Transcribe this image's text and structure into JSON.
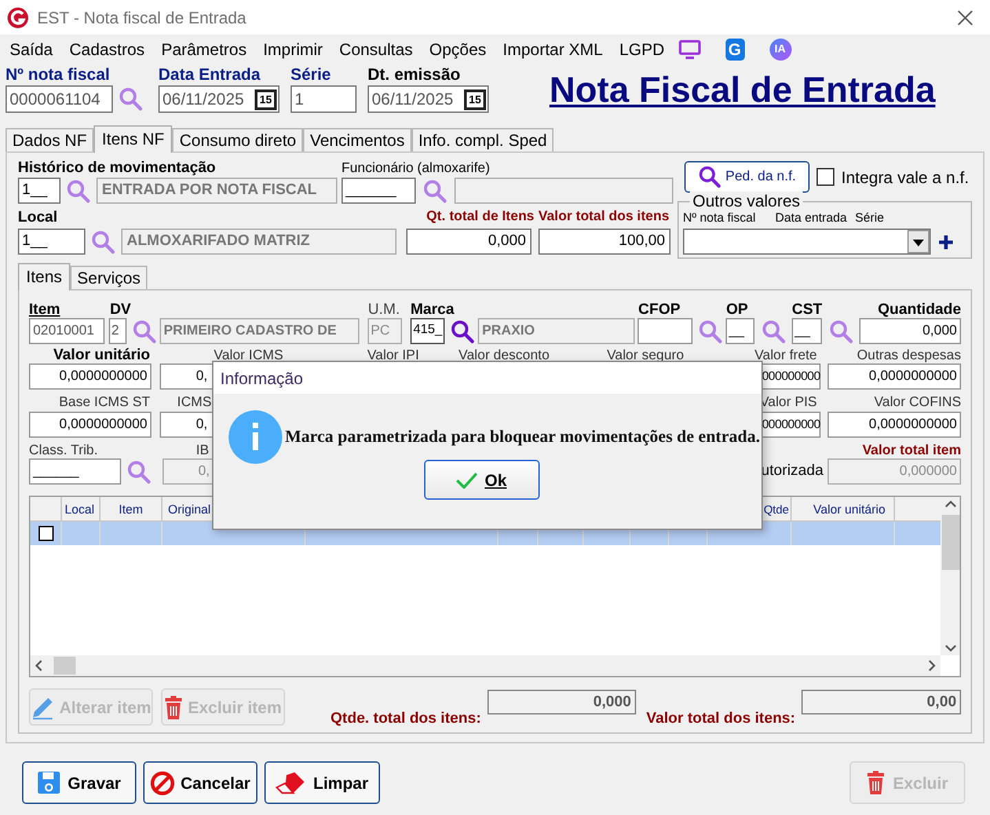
{
  "window": {
    "title": "EST - Nota fiscal de Entrada"
  },
  "menu": [
    "Saída",
    "Cadastros",
    "Parâmetros",
    "Imprimir",
    "Consultas",
    "Opções",
    "Importar XML",
    "LGPD"
  ],
  "menu_badges": {
    "g": "G",
    "ia": "IA"
  },
  "header": {
    "numero": {
      "label": "Nº nota fiscal",
      "value": "0000061104"
    },
    "data_entrada": {
      "label": "Data Entrada",
      "value": "06/11/2025",
      "calendar": "15"
    },
    "serie": {
      "label": "Série",
      "value": "1"
    },
    "dt_emissao": {
      "label": "Dt. emissão",
      "value": "06/11/2025",
      "calendar": "15"
    },
    "title": "Nota Fiscal de Entrada"
  },
  "tabs": [
    {
      "label": "Dados NF",
      "selected": false
    },
    {
      "label": "Itens NF",
      "selected": true
    },
    {
      "label": "Consumo direto",
      "selected": false
    },
    {
      "label": "Vencimentos",
      "selected": false
    },
    {
      "label": "Info. compl. Sped",
      "selected": false
    }
  ],
  "movimentacao": {
    "historico": {
      "label": "Histórico de movimentação",
      "code": "1__",
      "description": "ENTRADA POR NOTA FISCAL"
    },
    "funcionario": {
      "label": "Funcionário (almoxarife)",
      "code": "______"
    },
    "ped_button": "Ped. da n.f.",
    "integra": {
      "label": "Integra vale a n.f.",
      "checked": false
    },
    "local": {
      "label": "Local",
      "code": "1__",
      "description": "ALMOXARIFADO MATRIZ"
    },
    "qt_total": {
      "label": "Qt. total de Itens",
      "value": "0,000"
    },
    "valor_total": {
      "label": "Valor total dos itens",
      "value": "100,00"
    },
    "outros": {
      "legend": "Outros valores",
      "columns": [
        "Nº nota fiscal",
        "Data entrada",
        "Série"
      ]
    }
  },
  "subtabs": [
    {
      "label": "Itens",
      "selected": true
    },
    {
      "label": "Serviços",
      "selected": false
    }
  ],
  "item": {
    "item": {
      "label": "Item",
      "value": "02010001"
    },
    "dv": {
      "label": "DV",
      "value": "2",
      "description": "PRIMEIRO CADASTRO DE"
    },
    "um": {
      "label": "U.M.",
      "value": "PC"
    },
    "marca": {
      "label": "Marca",
      "value": "415_",
      "description": "PRAXIO"
    },
    "cfop": {
      "label": "CFOP"
    },
    "op": {
      "label": "OP",
      "value": "__"
    },
    "cst": {
      "label": "CST",
      "value": "__"
    },
    "quantidade": {
      "label": "Quantidade",
      "value": "0,000"
    },
    "valor_unitario": {
      "label": "Valor unitário",
      "value": "0,0000000000"
    },
    "valor_icms": {
      "label": "Valor ICMS",
      "value": "0,"
    },
    "valor_ipi": {
      "label": "Valor IPI"
    },
    "valor_desconto": {
      "label": "Valor desconto"
    },
    "valor_seguro": {
      "label": "Valor seguro"
    },
    "valor_frete": {
      "label": "Valor frete",
      "value": "000000000"
    },
    "outras_despesas": {
      "label": "Outras despesas",
      "value": "0,0000000000"
    },
    "base_icms_st": {
      "label": "Base ICMS ST",
      "value": "0,0000000000"
    },
    "icms": {
      "label": "ICMS",
      "value": "0,"
    },
    "valor_pis": {
      "label": "Valor PIS",
      "value": "000000000"
    },
    "valor_cofins": {
      "label": "Valor COFINS",
      "value": "0,0000000000"
    },
    "class_trib": {
      "label": "Class. Trib.",
      "value": "______"
    },
    "ib": {
      "label": "IB",
      "value": "0,"
    },
    "autorizada": {
      "label": "utorizada"
    },
    "valor_total_item": {
      "label": "Valor total item",
      "value": "0,000000"
    }
  },
  "table": {
    "columns": [
      "Local",
      "Item",
      "Original",
      "Qtde",
      "Valor unitário"
    ],
    "rows": [
      {
        "selected": true,
        "checked": false
      }
    ]
  },
  "item_buttons": [
    {
      "label": "Alterar item",
      "disabled": true
    },
    {
      "label": "Excluir item",
      "disabled": true
    }
  ],
  "totals": {
    "qtde": {
      "label": "Qtde. total dos itens:",
      "value": "0,000"
    },
    "valor": {
      "label": "Valor total dos itens:",
      "value": "0,00"
    }
  },
  "buttons": [
    {
      "label": "Gravar",
      "disabled": false
    },
    {
      "label": "Cancelar",
      "disabled": false
    },
    {
      "label": "Limpar",
      "disabled": false
    },
    {
      "label": "Excluir",
      "disabled": true
    }
  ],
  "dialog": {
    "title": "Informação",
    "message": "Marca parametrizada para bloquear movimentações de entrada.",
    "button": "Ok"
  }
}
